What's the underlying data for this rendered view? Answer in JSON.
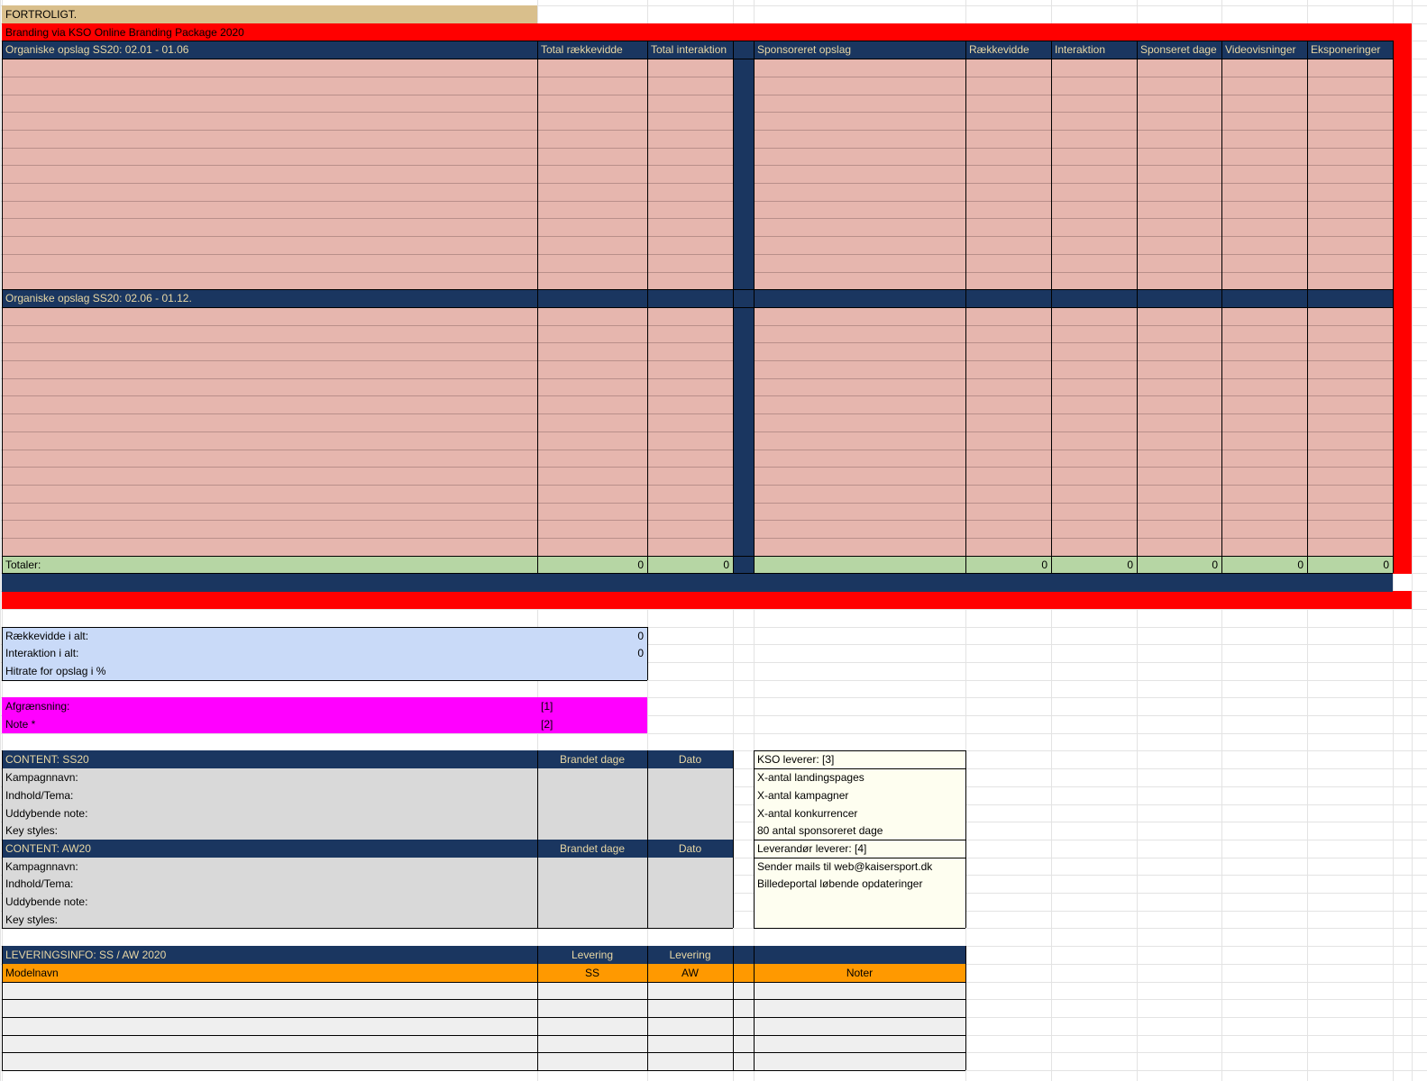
{
  "colors": {
    "tan": "#d9bf8c",
    "red": "#ff0000",
    "navy": "#1a3660",
    "navy_text": "#e8d7a4",
    "pink": "#e6b6ae",
    "green": "#b6d6a4",
    "lightblue": "#c9daf8",
    "magenta": "#ff00ff",
    "grey": "#d9d9d9",
    "cream": "#fefef0",
    "orange": "#ff9900",
    "lightgrey": "#efefef"
  },
  "title": "FORTROLIGT.",
  "banner": "Branding via KSO Online  Branding  Package 2020",
  "headers": {
    "organic1": "Organiske opslag SS20: 02.01 - 01.06",
    "total_reach": "Total rækkevidde",
    "total_interaction": "Total interaktion",
    "sponsored": "Sponsoreret opslag",
    "reach": "Rækkevidde",
    "interaction": "Interaktion",
    "sponsored_days": "Sponseret dage",
    "video_views": "Videovisninger",
    "exposures": "Eksponeringer",
    "organic2": "Organiske opslag SS20: 02.06 - 01.12."
  },
  "totals": {
    "label": "Totaler:",
    "total_reach": "0",
    "total_interaction": "0",
    "reach": "0",
    "interaction": "0",
    "sponsored_days": "0",
    "video_views": "0",
    "exposures": "0"
  },
  "summary": [
    {
      "label": "Rækkevidde i alt:",
      "value": "0"
    },
    {
      "label": "Interaktion i alt:",
      "value": "0"
    },
    {
      "label": "Hitrate for opslag i %",
      "value": ""
    }
  ],
  "notes": [
    {
      "label": "Afgrænsning:",
      "ref": "[1]"
    },
    {
      "label": "Note *",
      "ref": "[2]"
    }
  ],
  "content_ss20": {
    "title": "CONTENT: SS20",
    "col1": "Brandet dage",
    "col2": "Dato",
    "rows": [
      "Kampagnnavn:",
      "Indhold/Tema:",
      "Uddybende note:",
      "Key styles:"
    ]
  },
  "content_aw20": {
    "title": "CONTENT: AW20",
    "col1": "Brandet dage",
    "col2": "Dato",
    "rows": [
      "Kampagnnavn:",
      "Indhold/Tema:",
      "Uddybende note:",
      "Key styles:"
    ]
  },
  "kso": {
    "items": [
      "KSO leverer: [3]",
      "X-antal landingspages",
      "X-antal kampagner",
      "X-antal konkurrencer",
      "80 antal sponsoreret dage",
      "Leverandør leverer: [4]",
      "Sender mails til web@kaisersport.dk",
      "Billedeportal løbende opdateringer",
      "",
      ""
    ]
  },
  "delivery": {
    "title": "LEVERINGSINFO: SS / AW 2020",
    "levering1": "Levering",
    "levering2": "Levering",
    "model": "Modelnavn",
    "ss": "SS",
    "aw": "AW",
    "notes": "Noter"
  }
}
